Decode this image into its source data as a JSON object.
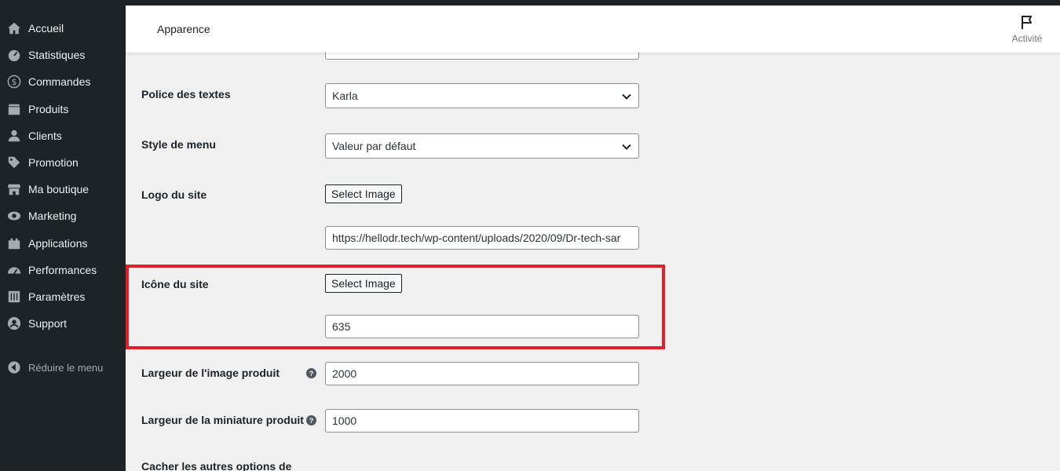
{
  "sidebar": {
    "items": [
      {
        "label": "Accueil",
        "icon": "home-icon"
      },
      {
        "label": "Statistiques",
        "icon": "dashboard-icon"
      },
      {
        "label": "Commandes",
        "icon": "dollar-icon"
      },
      {
        "label": "Produits",
        "icon": "archive-icon"
      },
      {
        "label": "Clients",
        "icon": "user-icon"
      },
      {
        "label": "Promotion",
        "icon": "tag-icon"
      },
      {
        "label": "Ma boutique",
        "icon": "store-icon"
      },
      {
        "label": "Marketing",
        "icon": "megaphone-icon"
      },
      {
        "label": "Applications",
        "icon": "plugin-icon"
      },
      {
        "label": "Performances",
        "icon": "gauge-icon"
      },
      {
        "label": "Paramètres",
        "icon": "sliders-icon"
      },
      {
        "label": "Support",
        "icon": "support-icon"
      }
    ],
    "collapse_label": "Réduire le menu"
  },
  "header": {
    "title": "Apparence",
    "activity_label": "Activité"
  },
  "form": {
    "font": {
      "label": "Police des textes",
      "value": "Karla"
    },
    "menu_style": {
      "label": "Style de menu",
      "value": "Valeur par défaut"
    },
    "logo": {
      "label": "Logo du site",
      "button": "Select Image",
      "value": "https://hellodr.tech/wp-content/uploads/2020/09/Dr-tech-sar"
    },
    "icon": {
      "label": "Icône du site",
      "button": "Select Image",
      "value": "635"
    },
    "product_width": {
      "label": "Largeur de l'image produit",
      "value": "2000"
    },
    "thumb_width": {
      "label": "Largeur de la miniature produit",
      "value": "1000"
    },
    "hide_options": {
      "label": "Cacher les autres options de"
    }
  },
  "colors": {
    "sidebar_bg": "#1d2327",
    "highlight": "#e31e24",
    "page_bg": "#f0f0f1"
  }
}
